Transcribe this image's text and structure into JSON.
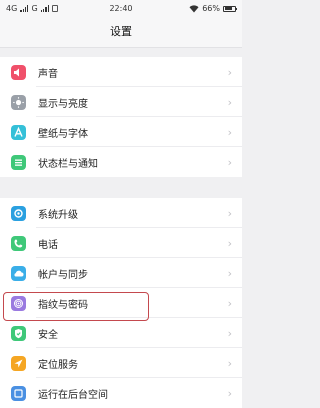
{
  "status_bar": {
    "network_1": "4G",
    "network_2": "G",
    "time": "22:40",
    "battery_text": "66%",
    "battery_level": 0.66
  },
  "header": {
    "title": "设置"
  },
  "group_1": [
    {
      "label": "声音",
      "icon": "speaker-icon",
      "color": "#f0506a"
    },
    {
      "label": "显示与亮度",
      "icon": "brightness-icon",
      "color": "#9aa0a8"
    },
    {
      "label": "壁纸与字体",
      "icon": "font-icon",
      "color": "#35c0d8"
    },
    {
      "label": "状态栏与通知",
      "icon": "notification-list-icon",
      "color": "#3fc879"
    }
  ],
  "group_2": [
    {
      "label": "系统升级",
      "icon": "update-icon",
      "color": "#2aa0e0"
    },
    {
      "label": "电话",
      "icon": "phone-icon",
      "color": "#3fc879"
    },
    {
      "label": "帐户与同步",
      "icon": "cloud-sync-icon",
      "color": "#3aaee8"
    },
    {
      "label": "指纹与密码",
      "icon": "fingerprint-icon",
      "color": "#9a7ae0"
    },
    {
      "label": "安全",
      "icon": "shield-icon",
      "color": "#3fc879"
    },
    {
      "label": "定位服务",
      "icon": "location-icon",
      "color": "#f5a623"
    },
    {
      "label": "运行在后台空间",
      "icon": "background-space-icon",
      "color": "#4a90e2"
    }
  ],
  "highlight_color": "#c4494e"
}
